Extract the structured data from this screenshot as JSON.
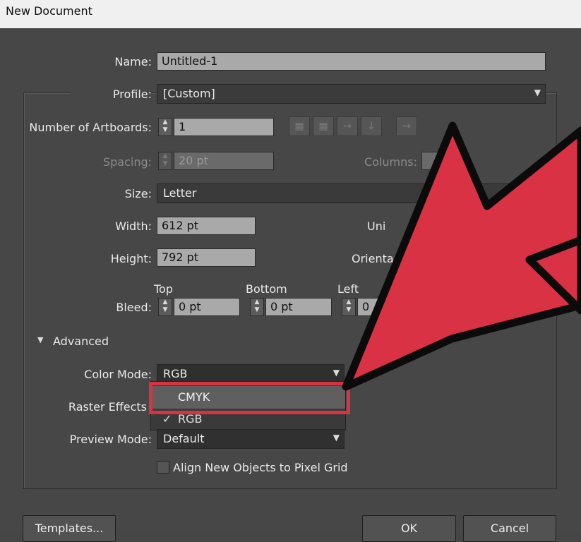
{
  "window": {
    "title": "New Document"
  },
  "form": {
    "name_label": "Name:",
    "name_value": "Untitled-1",
    "profile_label": "Profile:",
    "profile_value": "[Custom]",
    "artboards_label": "Number of Artboards:",
    "artboards_value": "1",
    "spacing_label": "Spacing:",
    "spacing_value": "20 pt",
    "columns_label": "Columns:",
    "size_label": "Size:",
    "size_value": "Letter",
    "width_label": "Width:",
    "width_value": "612 pt",
    "units_label": "Uni",
    "height_label": "Height:",
    "height_value": "792 pt",
    "orientation_label": "Orienta",
    "bleed_label": "Bleed:",
    "bleed_top_label": "Top",
    "bleed_top_value": "0 pt",
    "bleed_bottom_label": "Bottom",
    "bleed_bottom_value": "0 pt",
    "bleed_left_label": "Left",
    "bleed_left_value": "0"
  },
  "advanced": {
    "header": "Advanced",
    "color_mode_label": "Color Mode:",
    "color_mode_value": "RGB",
    "raster_label": "Raster Effects",
    "preview_label": "Preview Mode:",
    "preview_value": "Default",
    "pixel_grid_label": "Align New Objects to Pixel Grid"
  },
  "color_menu": {
    "options": [
      "CMYK",
      "RGB"
    ],
    "checkmark": "✓"
  },
  "buttons": {
    "templates": "Templates...",
    "ok": "OK",
    "cancel": "Cancel"
  },
  "annotation": {
    "arrow_color": "#d83244",
    "highlight_color": "#d83244"
  },
  "icons": {
    "artboard_layout": [
      "grid-by-row-icon",
      "grid-by-column-icon",
      "arrange-by-row-icon",
      "arrange-by-column-icon",
      "right-to-left-icon"
    ]
  }
}
